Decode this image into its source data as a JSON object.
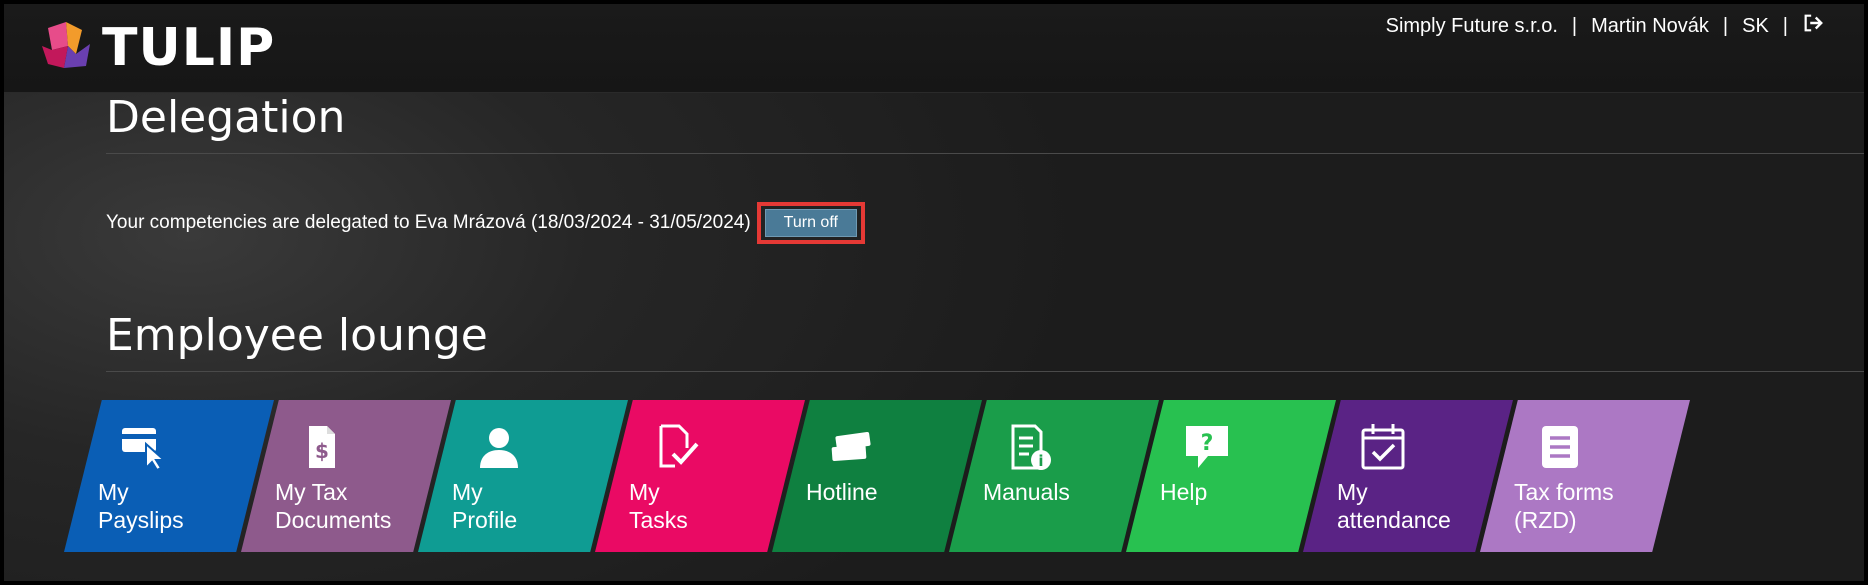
{
  "header": {
    "logo_text": "TULIP",
    "company": "Simply Future s.r.o.",
    "separator": "|",
    "user": "Martin Novák",
    "language": "SK"
  },
  "delegation": {
    "title": "Delegation",
    "message": "Your competencies are delegated to Eva Mrázová (18/03/2024 - 31/05/2024)",
    "turn_off_label": "Turn off"
  },
  "lounge": {
    "title": "Employee lounge",
    "tiles": [
      {
        "line1": "My",
        "line2": "Payslips",
        "color": "#0a5eb5",
        "icon": "card-click-icon"
      },
      {
        "line1": "My Tax",
        "line2": "Documents",
        "color": "#8e5a8c",
        "icon": "tax-document-icon"
      },
      {
        "line1": "My",
        "line2": "Profile",
        "color": "#0f9c93",
        "icon": "person-icon"
      },
      {
        "line1": "My",
        "line2": "Tasks",
        "color": "#ea0a64",
        "icon": "task-check-icon"
      },
      {
        "line1": "Hotline",
        "line2": "",
        "color": "#0f8040",
        "icon": "tickets-icon"
      },
      {
        "line1": "Manuals",
        "line2": "",
        "color": "#1a9d4a",
        "icon": "manual-info-icon"
      },
      {
        "line1": "Help",
        "line2": "",
        "color": "#28c150",
        "icon": "help-bubble-icon"
      },
      {
        "line1": "My",
        "line2": "attendance",
        "color": "#5a2385",
        "icon": "calendar-check-icon"
      },
      {
        "line1": "Tax forms",
        "line2": "(RZD)",
        "color": "#ac78c4",
        "icon": "form-list-icon"
      }
    ]
  }
}
